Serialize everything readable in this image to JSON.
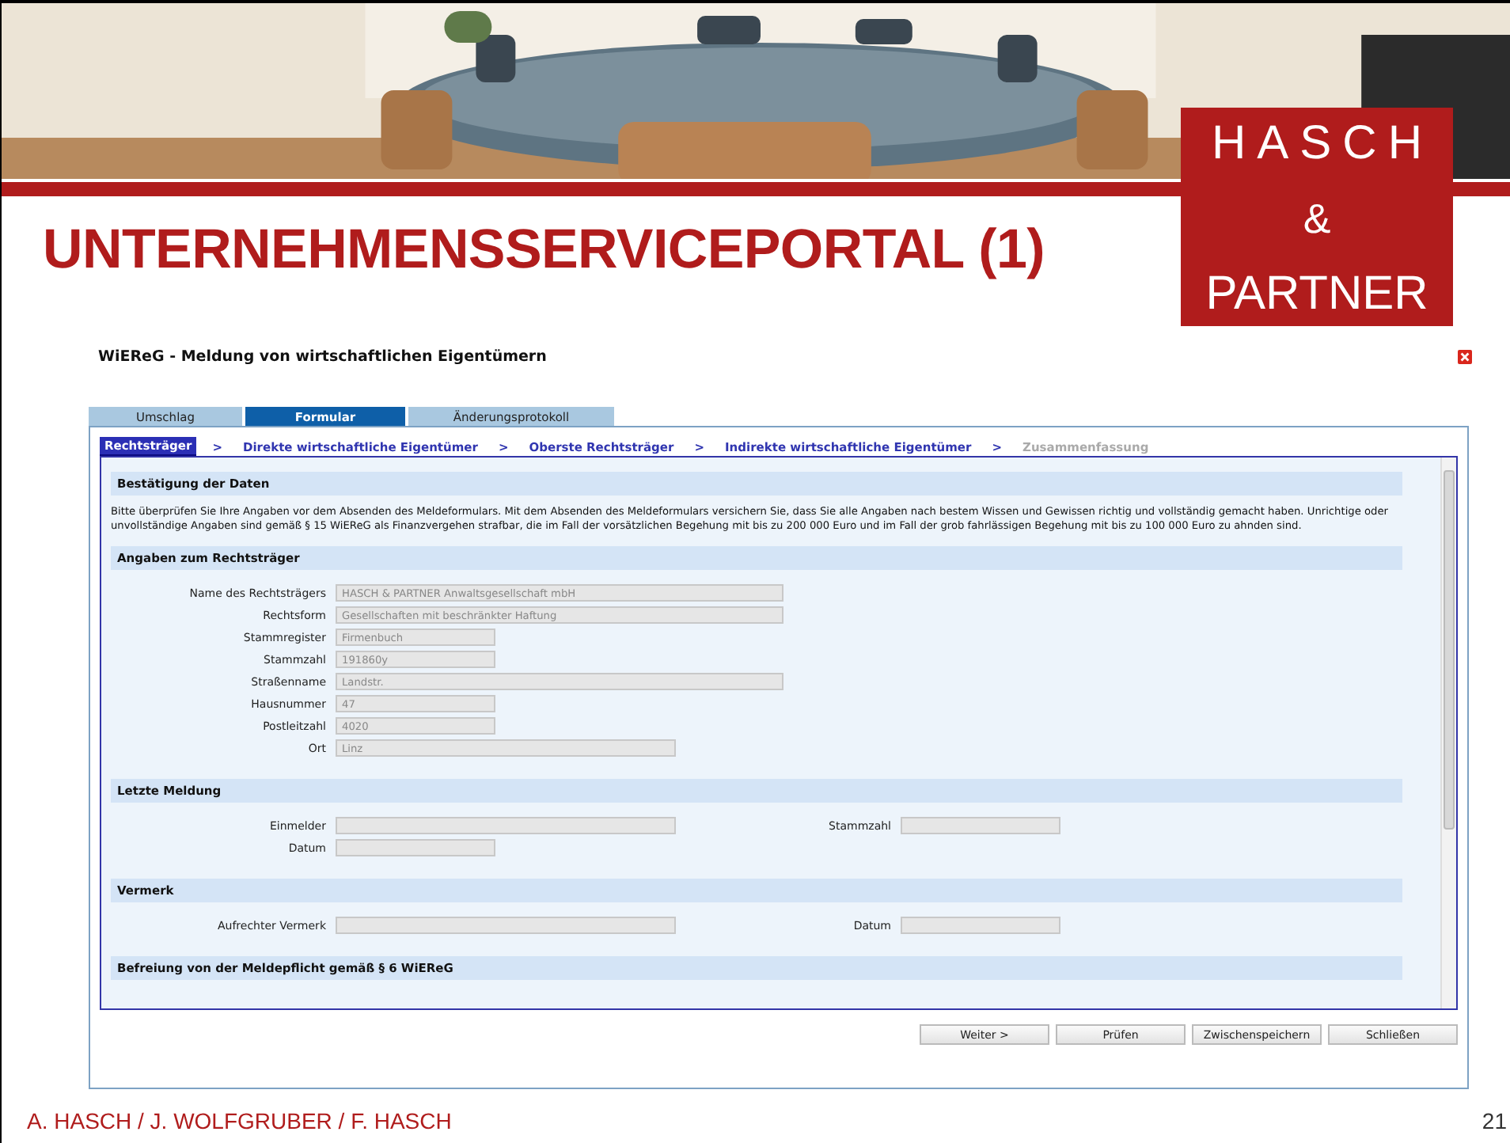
{
  "slide": {
    "title": "UNTERNEHMENSSERVICEPORTAL (1)",
    "logo": [
      "HASCH",
      "&",
      "PARTNER"
    ],
    "footer": "A. HASCH / J. WOLFGRUBER / F. HASCH",
    "page_number": "21"
  },
  "app": {
    "title": "WiEReG - Meldung von wirtschaftlichen Eigentümern",
    "tabs": [
      {
        "label": "Umschlag",
        "selected": false
      },
      {
        "label": "Formular",
        "selected": true
      },
      {
        "label": "Änderungsprotokoll",
        "selected": false
      }
    ],
    "steps": [
      {
        "kind": "step",
        "label": "Rechtsträger",
        "selected": true,
        "disabled": false
      },
      {
        "kind": "separator",
        "label": ">"
      },
      {
        "kind": "step",
        "label": "Direkte wirtschaftliche Eigentümer",
        "selected": false,
        "disabled": false
      },
      {
        "kind": "separator",
        "label": ">"
      },
      {
        "kind": "step",
        "label": "Oberste Rechtsträger",
        "selected": false,
        "disabled": false
      },
      {
        "kind": "separator",
        "label": ">"
      },
      {
        "kind": "step",
        "label": "Indirekte wirtschaftliche Eigentümer",
        "selected": false,
        "disabled": false
      },
      {
        "kind": "separator",
        "label": ">"
      },
      {
        "kind": "step",
        "label": "Zusammenfassung",
        "selected": false,
        "disabled": true
      }
    ],
    "sections": [
      {
        "title": "Bestätigung der Daten",
        "text": "Bitte überprüfen Sie Ihre Angaben vor dem Absenden des Meldeformulars. Mit dem Absenden des Meldeformulars versichern Sie, dass Sie alle Angaben nach bestem Wissen und Gewissen richtig und vollständig gemacht haben. Unrichtige oder unvollständige Angaben sind gemäß § 15 WiEReG als Finanzvergehen strafbar, die im Fall der vorsätzlichen Begehung mit bis zu 200 000 Euro und im Fall der grob fahrlässigen Begehung mit bis zu 100 000 Euro zu ahnden sind."
      },
      {
        "title": "Angaben zum Rechtsträger",
        "rows": [
          [
            {
              "label": "Name des Rechtsträgers",
              "value": "HASCH & PARTNER Anwaltsgesellschaft mbH",
              "kind": "long",
              "disabled": true
            }
          ],
          [
            {
              "label": "Rechtsform",
              "value": "Gesellschaften mit beschränkter Haftung",
              "kind": "long",
              "disabled": true
            }
          ],
          [
            {
              "label": "Stammregister",
              "value": "Firmenbuch",
              "kind": "short",
              "disabled": true
            }
          ],
          [
            {
              "label": "Stammzahl",
              "value": "191860y",
              "kind": "short",
              "disabled": true
            }
          ],
          [
            {
              "label": "Straßenname",
              "value": "Landstr.",
              "kind": "long",
              "disabled": true
            }
          ],
          [
            {
              "label": "Hausnummer",
              "value": "47",
              "kind": "short",
              "disabled": true
            }
          ],
          [
            {
              "label": "Postleitzahl",
              "value": "4020",
              "kind": "short",
              "disabled": true
            }
          ],
          [
            {
              "label": "Ort",
              "value": "Linz",
              "kind": "medium",
              "disabled": true
            }
          ]
        ]
      },
      {
        "title": "Letzte Meldung",
        "rows": [
          [
            {
              "label": "Einmelder",
              "kind": "medium",
              "disabled": true
            },
            {
              "label": "Stammzahl",
              "kind": "short",
              "disabled": true
            }
          ],
          [
            {
              "label": "Datum",
              "kind": "short",
              "disabled": true
            }
          ]
        ]
      },
      {
        "title": "Vermerk",
        "rows": [
          [
            {
              "label": "Aufrechter Vermerk",
              "kind": "medium",
              "disabled": true
            },
            {
              "label": "Datum",
              "kind": "short",
              "disabled": true
            }
          ]
        ]
      },
      {
        "title": "Befreiung von der Meldepflicht gemäß § 6 WiEReG"
      }
    ],
    "buttons": [
      "Weiter >",
      "Prüfen",
      "Zwischenspeichern",
      "Schließen"
    ]
  }
}
